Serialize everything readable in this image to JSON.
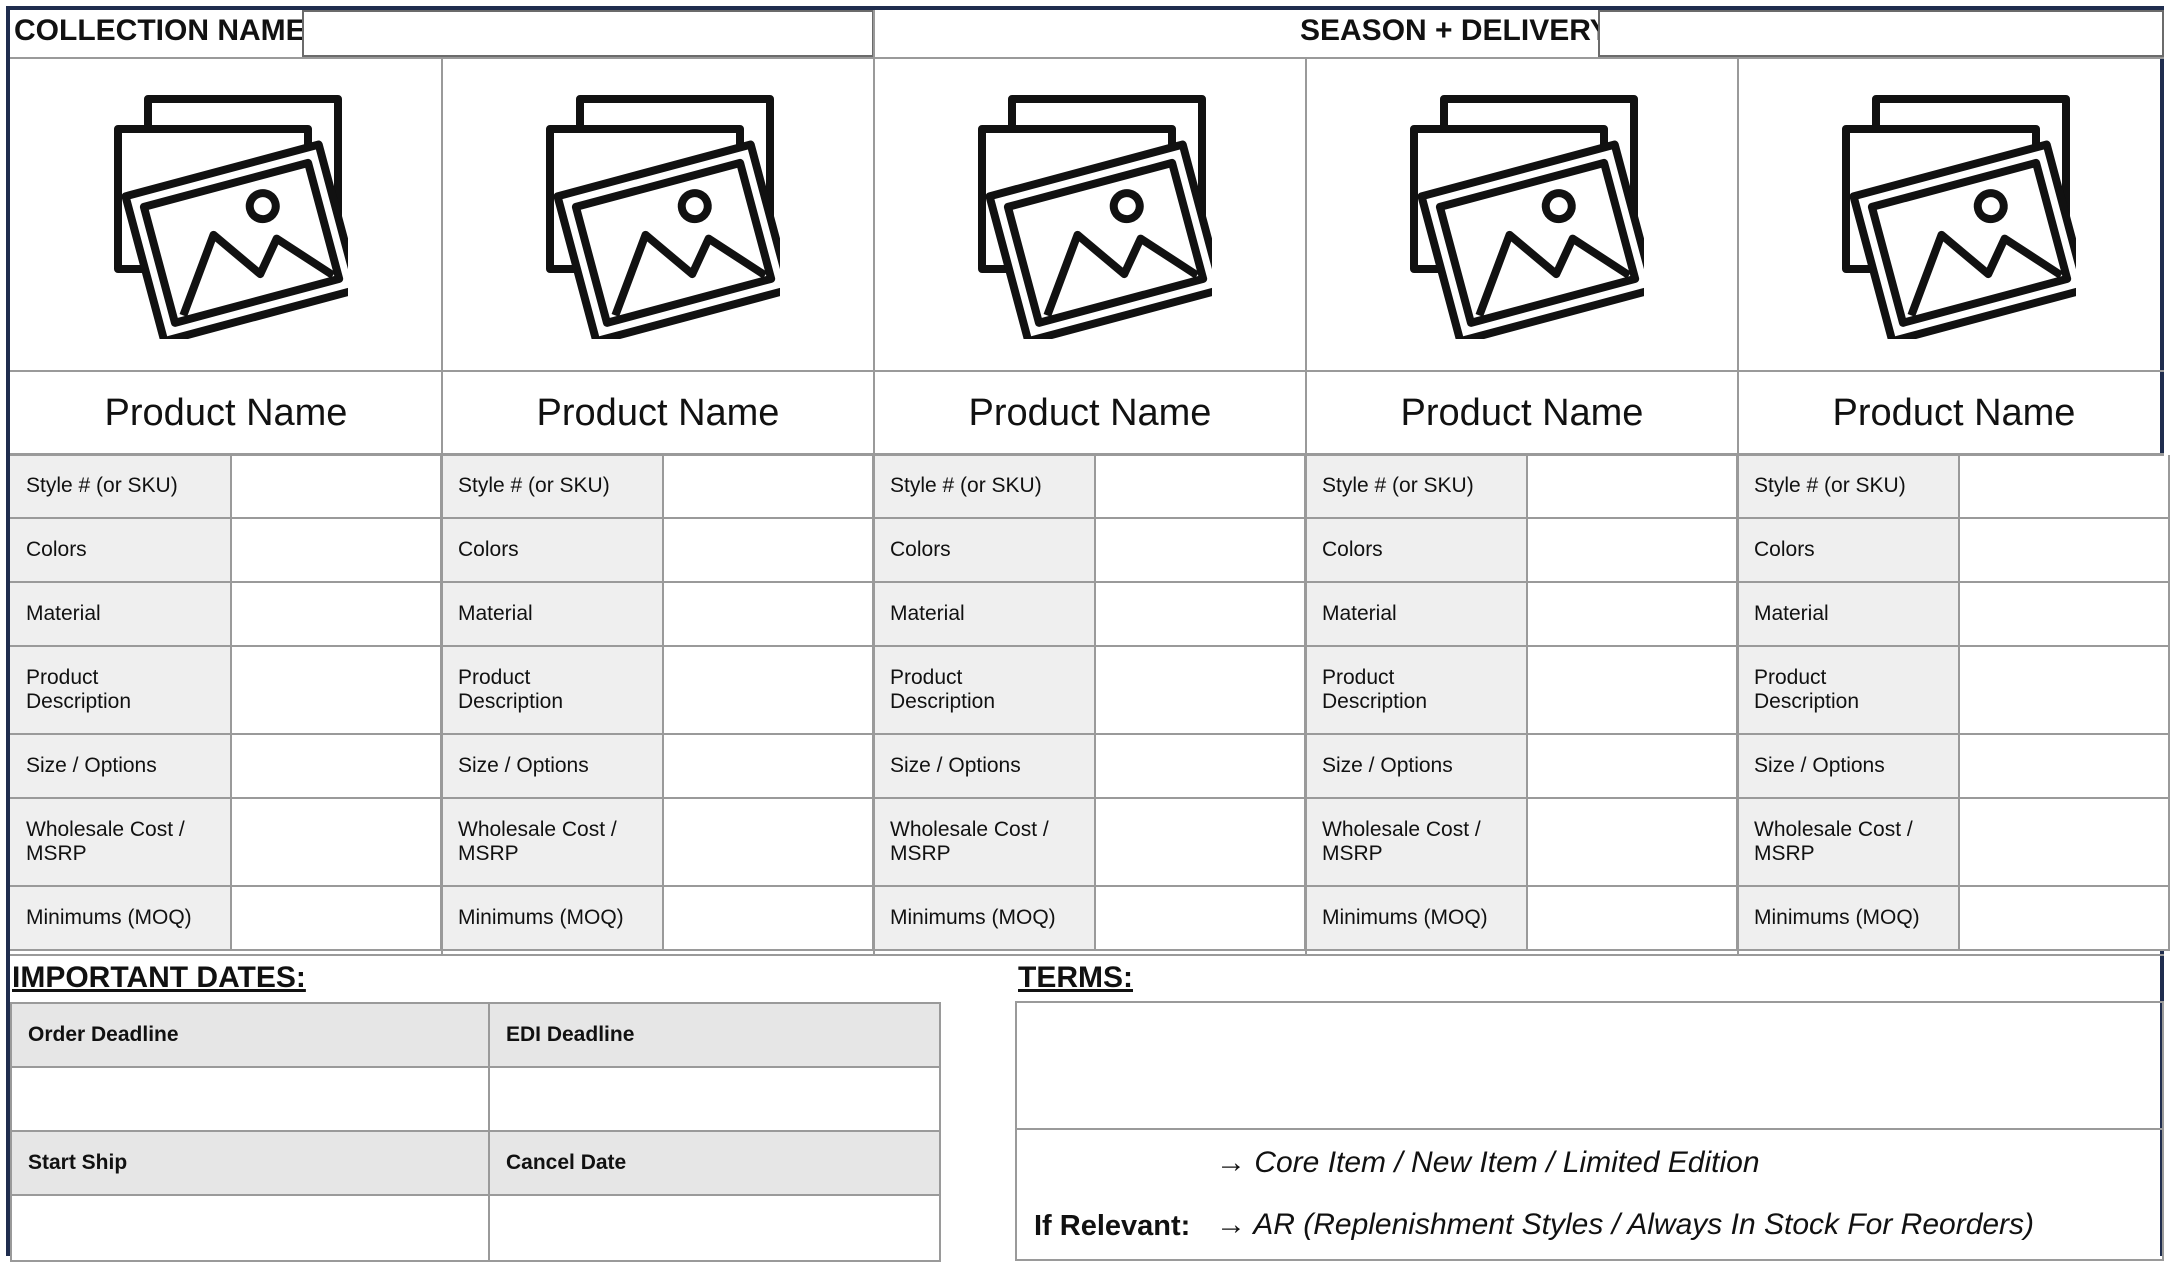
{
  "header": {
    "collection_label": "COLLECTION NAME:",
    "collection_value": "",
    "season_label": "SEASON + DELIVERY:",
    "season_value": ""
  },
  "products": [
    {
      "name": "Product Name",
      "image_icon": "image-gallery-icon"
    },
    {
      "name": "Product Name",
      "image_icon": "image-gallery-icon"
    },
    {
      "name": "Product Name",
      "image_icon": "image-gallery-icon"
    },
    {
      "name": "Product Name",
      "image_icon": "image-gallery-icon"
    },
    {
      "name": "Product Name",
      "image_icon": "image-gallery-icon"
    }
  ],
  "spec_rows": [
    {
      "label": "Style # (or SKU)",
      "values": [
        "",
        "",
        "",
        "",
        ""
      ]
    },
    {
      "label": "Colors",
      "values": [
        "",
        "",
        "",
        "",
        ""
      ]
    },
    {
      "label": "Material",
      "values": [
        "",
        "",
        "",
        "",
        ""
      ]
    },
    {
      "label": "Product Description",
      "values": [
        "",
        "",
        "",
        "",
        ""
      ]
    },
    {
      "label": "Size / Options",
      "values": [
        "",
        "",
        "",
        "",
        ""
      ]
    },
    {
      "label": "Wholesale Cost / MSRP",
      "values": [
        "",
        "",
        "",
        "",
        ""
      ]
    },
    {
      "label": "Minimums (MOQ)",
      "values": [
        "",
        "",
        "",
        "",
        ""
      ]
    }
  ],
  "important_dates": {
    "title": "IMPORTANT DATES:",
    "order_deadline_label": "Order Deadline",
    "order_deadline_value": "",
    "edi_deadline_label": "EDI Deadline",
    "edi_deadline_value": "",
    "start_ship_label": "Start Ship",
    "start_ship_value": "",
    "cancel_date_label": "Cancel Date",
    "cancel_date_value": ""
  },
  "terms": {
    "title": "TERMS:",
    "value": "",
    "if_relevant_label": "If Relevant:",
    "options": [
      "→ Core Item / New Item / Limited Edition",
      "→ AR (Replenishment Styles / Always In Stock For Reorders)"
    ]
  },
  "colors": {
    "frame_border": "#1f2d4e",
    "label_bg": "#efefef",
    "date_header_bg": "#e6e6e6",
    "grid_line": "#9a9a9a"
  }
}
